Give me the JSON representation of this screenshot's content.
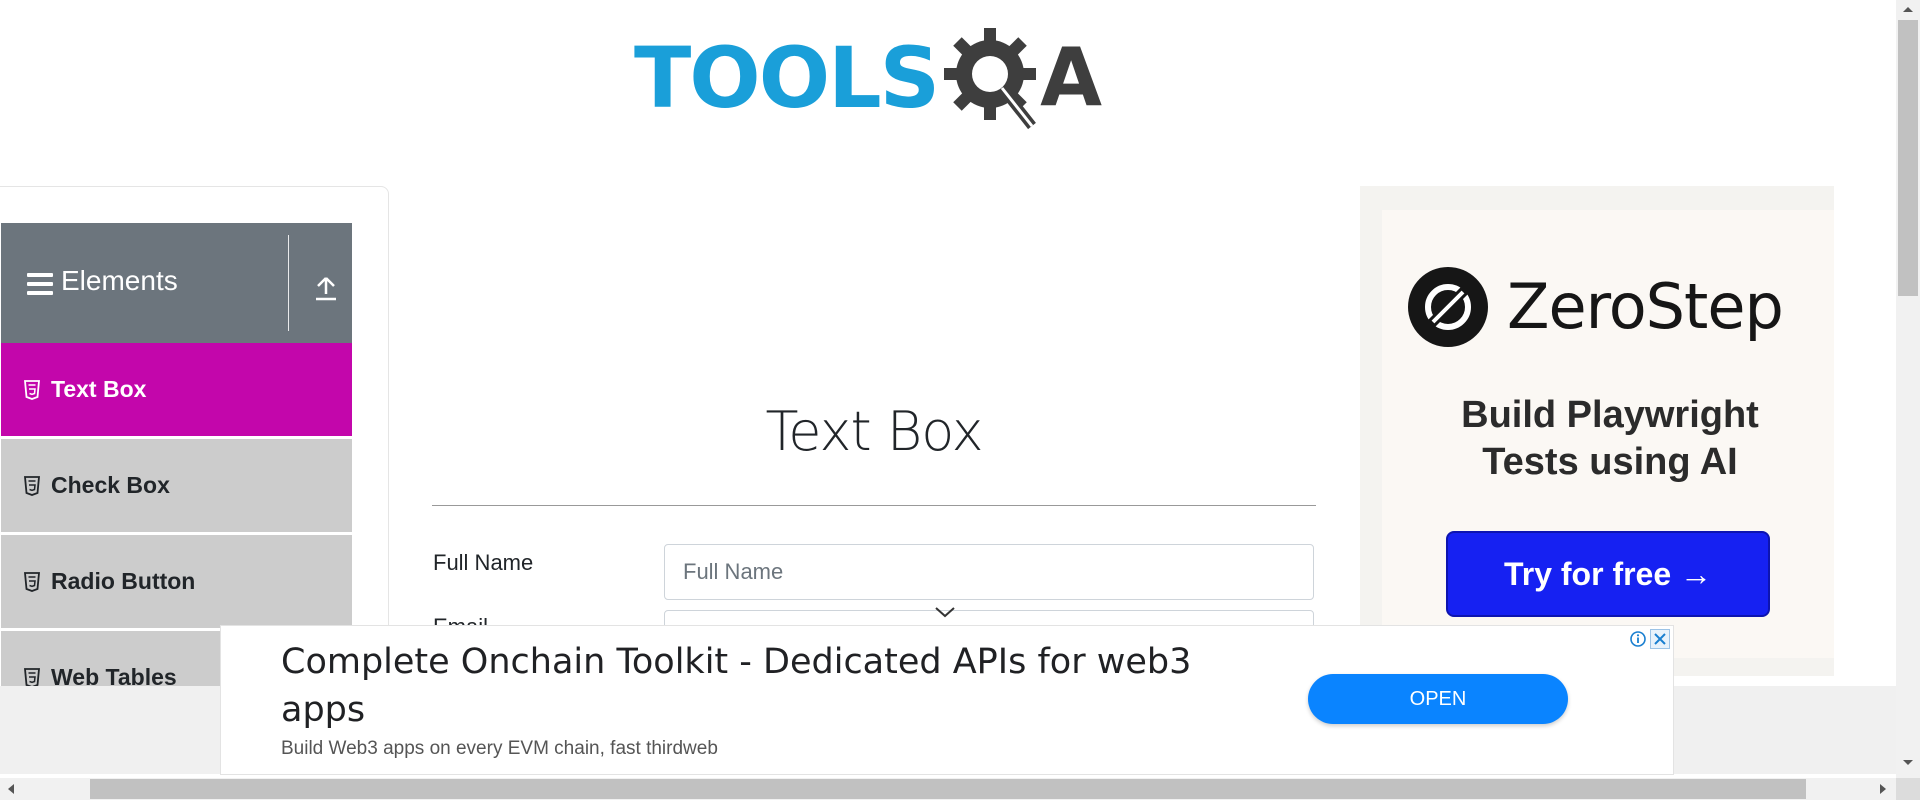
{
  "header": {
    "logo_text_left": "TOOLS",
    "logo_text_right": "A",
    "logo_gear_icon": "gear-magnifier-icon",
    "colors": {
      "logo_blue": "#1a9fd9",
      "logo_dark": "#3e3e3e"
    }
  },
  "sidebar": {
    "group_title": "Elements",
    "group_icon": "hamburger-icon",
    "collapse_icon": "upload-arrow-icon",
    "items": [
      {
        "label": "Text Box",
        "icon": "html5-icon",
        "active": true
      },
      {
        "label": "Check Box",
        "icon": "html5-icon",
        "active": false
      },
      {
        "label": "Radio Button",
        "icon": "html5-icon",
        "active": false
      },
      {
        "label": "Web Tables",
        "icon": "html5-icon",
        "active": false
      }
    ],
    "colors": {
      "header_bg": "#6c757d",
      "active_bg": "#c306ab",
      "item_bg": "#cccccc"
    }
  },
  "main": {
    "title": "Text Box",
    "fields": [
      {
        "label": "Full Name",
        "placeholder": "Full Name",
        "value": ""
      },
      {
        "label": "Email"
      }
    ]
  },
  "right_ad": {
    "brand": "ZeroStep",
    "tagline_line1": "Build Playwright",
    "tagline_line2": "Tests using AI",
    "cta": "Try for free →",
    "colors": {
      "cta_bg": "#1621f2"
    }
  },
  "bottom_ad": {
    "headline": "Complete Onchain Toolkit - Dedicated APIs for web3 apps",
    "subtext": "Build Web3 apps on every EVM chain, fast thirdweb",
    "button": "OPEN",
    "adchoices_icon": "info-icon",
    "close_icon": "close-icon",
    "colors": {
      "button_bg": "#0a84ff"
    }
  }
}
